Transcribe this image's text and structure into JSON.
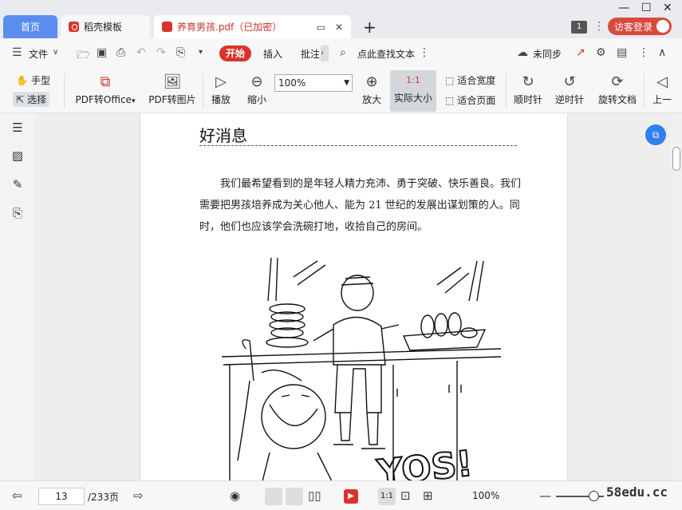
{
  "tabs": {
    "home": "首页",
    "template": "稻壳模板",
    "doc": "养育男孩.pdf（已加密）",
    "badge": "1"
  },
  "account": {
    "visitor_login": "访客登录"
  },
  "menubar": {
    "file": "文件",
    "start": "开始",
    "insert": "插入",
    "annotate": "批注",
    "search": "点此查找文本",
    "sync": "未同步"
  },
  "ribbon": {
    "hand": "手型",
    "select": "选择",
    "pdf_to_office": "PDF转Office",
    "pdf_to_image": "PDF转图片",
    "play": "播放",
    "zoom_out": "缩小",
    "zoom_value": "100%",
    "zoom_in": "放大",
    "actual_size": "实际大小",
    "actual_size_icon": "1:1",
    "fit_width": "适合宽度",
    "fit_page": "适合页面",
    "rotate_cw": "顺时针",
    "rotate_ccw": "逆时针",
    "rotate_doc": "旋转文档",
    "prev_page": "上一"
  },
  "document": {
    "title": "好消息",
    "paragraph": "我们最希望看到的是年轻人精力充沛、勇于突破、快乐善良。我们需要把男孩培养成为关心他人、能为 21 世纪的发展出谋划策的人。同时，他们也应该学会洗碗打地，收拾自己的房间。",
    "illustration_text": "YOS!"
  },
  "statusbar": {
    "current_page": "13",
    "total_pages": "/233页",
    "zoom": "100%"
  },
  "watermark": "58edu.cc"
}
